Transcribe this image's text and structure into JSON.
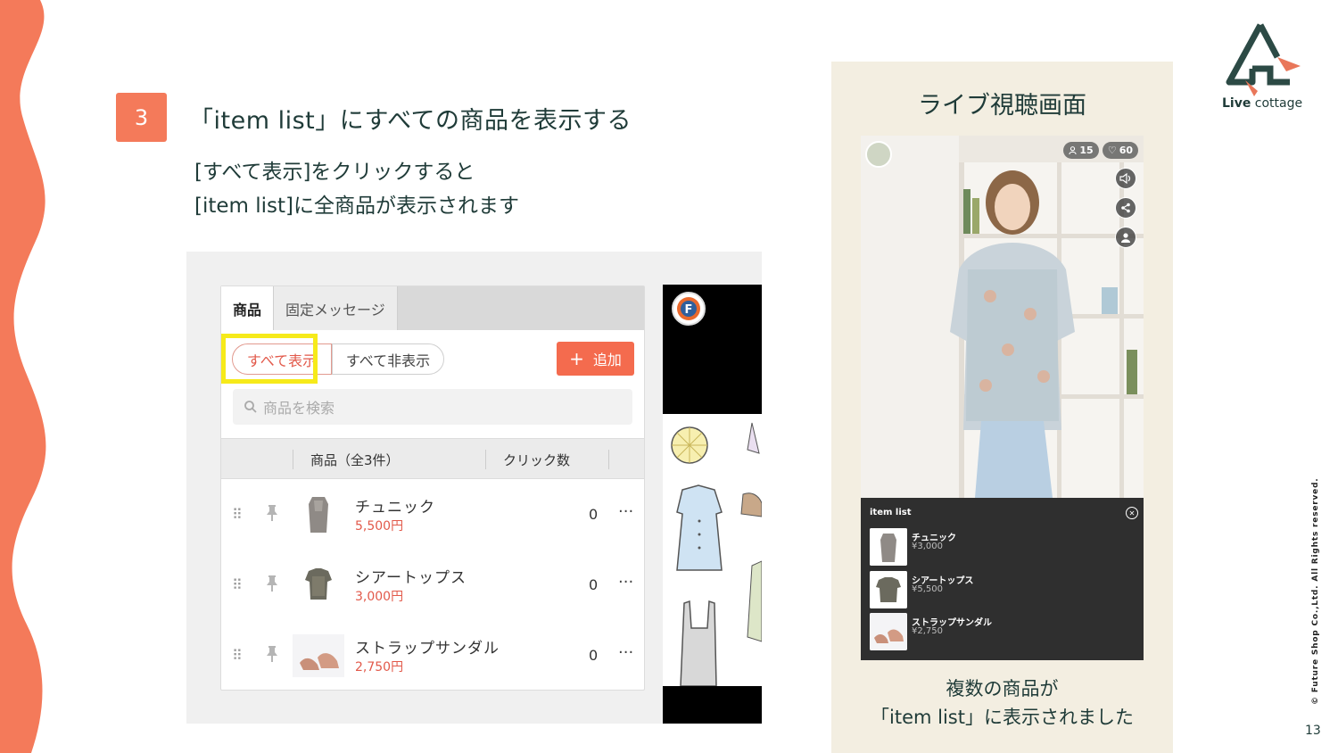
{
  "step": {
    "number": "3",
    "heading": "「item list」にすべての商品を表示する"
  },
  "description": {
    "line1": "[すべて表示]をクリックすると",
    "line2": "[item list]に全商品が表示されます"
  },
  "admin": {
    "tabs": [
      "商品",
      "固定メッセージ"
    ],
    "show_all_label": "すべて表示",
    "hide_all_label": "すべて非表示",
    "add_label": "追加",
    "search_placeholder": "商品を検索",
    "col_product": "商品（全3件）",
    "col_clicks": "クリック数",
    "products": [
      {
        "name": "チュニック",
        "price": "5,500円",
        "clicks": "0"
      },
      {
        "name": "シアートップス",
        "price": "3,000円",
        "clicks": "0"
      },
      {
        "name": "ストラップサンダル",
        "price": "2,750円",
        "clicks": "0"
      }
    ],
    "more_label": "···"
  },
  "viewer": {
    "title": "ライブ視聴画面",
    "viewers": "15",
    "likes": "60",
    "item_list_title": "item list",
    "items": [
      {
        "name": "チュニック",
        "price": "¥3,000"
      },
      {
        "name": "シアートップス",
        "price": "¥5,500"
      },
      {
        "name": "ストラップサンダル",
        "price": "¥2,750"
      }
    ],
    "caption_line1": "複数の商品が",
    "caption_line2": "「item list」に表示されました"
  },
  "brand": {
    "bold": "Live",
    "rest": " cottage"
  },
  "footer": {
    "copyright": "© Future Shop Co.,Ltd. All Rights reserved.",
    "page": "13"
  },
  "colors": {
    "accent": "#f47a5a",
    "highlight": "#f6ea1a",
    "text": "#1f3b38",
    "card_bg": "#f3eee1"
  }
}
